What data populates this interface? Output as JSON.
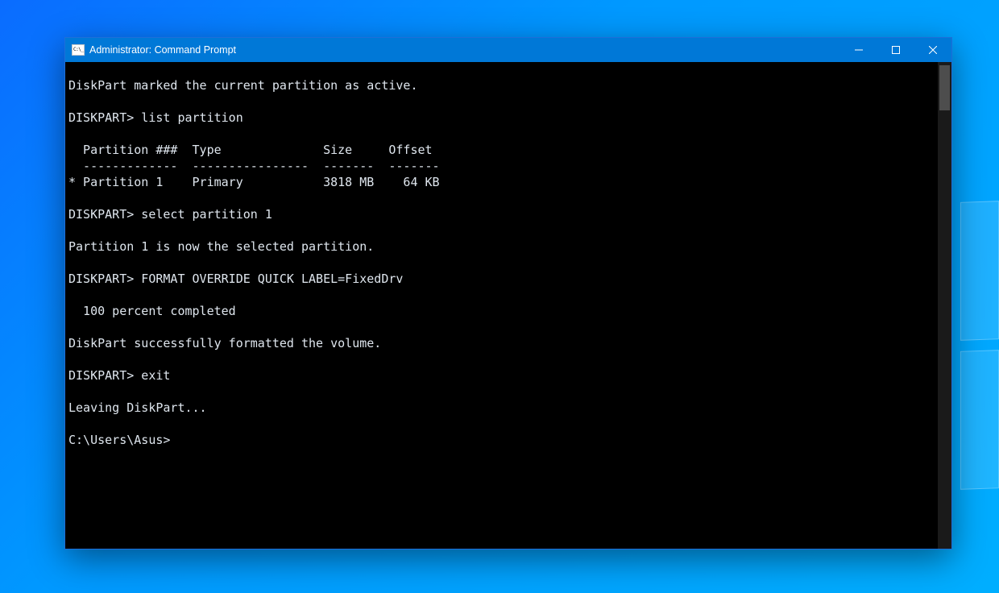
{
  "desktop": {
    "accent": "#0078d7"
  },
  "window": {
    "title": "Administrator: Command Prompt",
    "icon_name": "cmd-icon",
    "controls": {
      "minimize": "minimize",
      "maximize": "maximize",
      "close": "close"
    }
  },
  "terminal": {
    "font": "Consolas",
    "foreground": "#dfe6ee",
    "background": "#000000",
    "prompt_diskpart": "DISKPART>",
    "prompt_shell": "C:\\Users\\Asus>",
    "lines": [
      "DiskPart marked the current partition as active.",
      "",
      "DISKPART> list partition",
      "",
      "  Partition ###  Type              Size     Offset",
      "  -------------  ----------------  -------  -------",
      "* Partition 1    Primary           3818 MB    64 KB",
      "",
      "DISKPART> select partition 1",
      "",
      "Partition 1 is now the selected partition.",
      "",
      "DISKPART> FORMAT OVERRIDE QUICK LABEL=FixedDrv",
      "",
      "  100 percent completed",
      "",
      "DiskPart successfully formatted the volume.",
      "",
      "DISKPART> exit",
      "",
      "Leaving DiskPart...",
      "",
      "C:\\Users\\Asus>"
    ],
    "partition_table": {
      "headers": [
        "Partition ###",
        "Type",
        "Size",
        "Offset"
      ],
      "rows": [
        {
          "selected": true,
          "id": "Partition 1",
          "type": "Primary",
          "size": "3818 MB",
          "offset": "64 KB"
        }
      ]
    },
    "commands": [
      "list partition",
      "select partition 1",
      "FORMAT OVERRIDE QUICK LABEL=FixedDrv",
      "exit"
    ]
  }
}
